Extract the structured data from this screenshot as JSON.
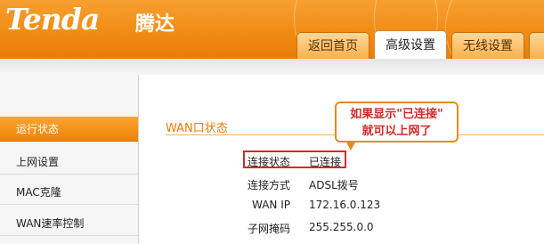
{
  "header": {
    "logo_text": "Tenda",
    "logo_cn": "腾达",
    "tabs": [
      {
        "label": "返回首页"
      },
      {
        "label": "高级设置"
      },
      {
        "label": "无线设置"
      }
    ],
    "active_tab": "高级设置",
    "brand_color": "#f08a12"
  },
  "sidebar": {
    "items": [
      {
        "label": "运行状态"
      },
      {
        "label": "上网设置"
      },
      {
        "label": "MAC克隆"
      },
      {
        "label": "WAN速率控制"
      }
    ],
    "active_item": "运行状态"
  },
  "main": {
    "section_title": "WAN口状态",
    "rows": [
      {
        "label": "连接状态",
        "value": "已连接"
      },
      {
        "label": "连接方式",
        "value": "ADSL拨号"
      },
      {
        "label": "WAN IP",
        "value": "172.16.0.123"
      },
      {
        "label": "子网掩码",
        "value": "255.255.0.0"
      }
    ]
  },
  "callout": {
    "line1": "如果显示\"已连接\"",
    "line2": "就可以上网了",
    "border_color": "#e8891c",
    "text_color": "#d62828"
  }
}
